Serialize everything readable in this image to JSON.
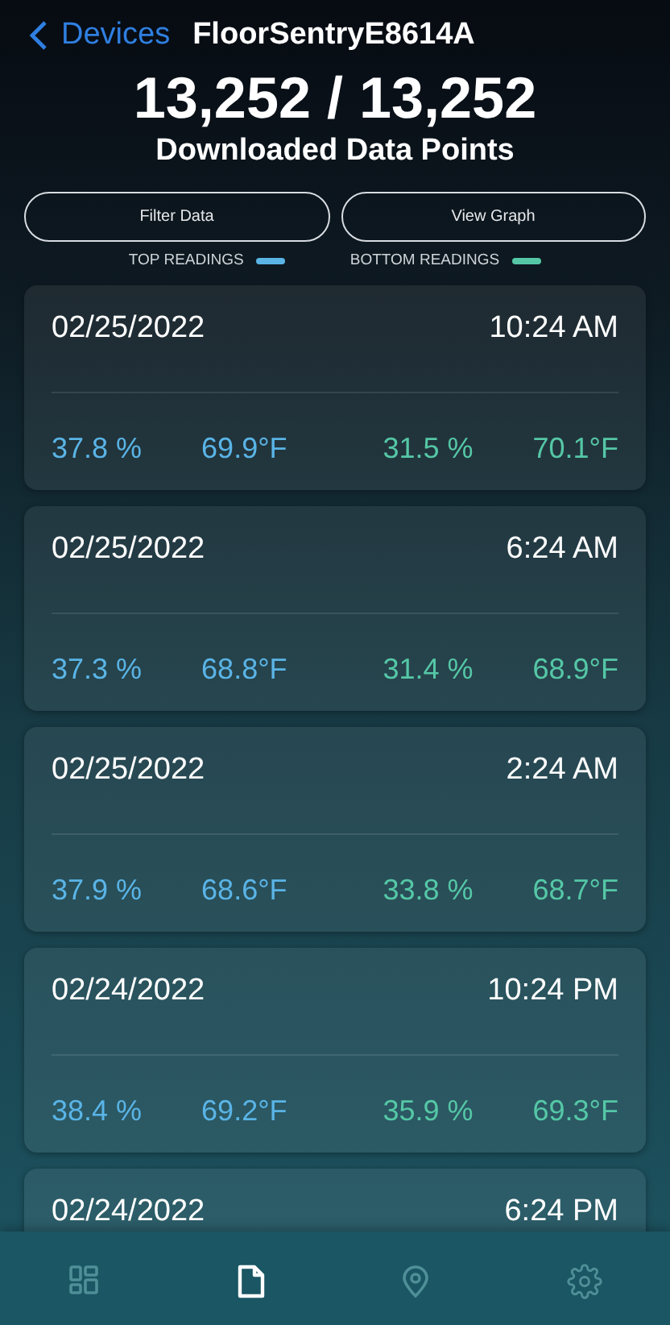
{
  "nav": {
    "back_label": "Devices",
    "title": "FloorSentryE8614A"
  },
  "summary": {
    "count": "13,252 / 13,252",
    "caption": "Downloaded Data Points"
  },
  "buttons": [
    "Filter Data",
    "View Graph"
  ],
  "legend": [
    {
      "label": "TOP READINGS",
      "color": "#5ab4e6"
    },
    {
      "label": "BOTTOM READINGS",
      "color": "#55c7a6"
    }
  ],
  "readings": [
    {
      "date": "02/25/2022",
      "time": "10:24 AM",
      "top_humidity": "37.8 %",
      "top_temp": "69.9°F",
      "bottom_humidity": "31.5 %",
      "bottom_temp": "70.1°F"
    },
    {
      "date": "02/25/2022",
      "time": "6:24 AM",
      "top_humidity": "37.3 %",
      "top_temp": "68.8°F",
      "bottom_humidity": "31.4 %",
      "bottom_temp": "68.9°F"
    },
    {
      "date": "02/25/2022",
      "time": "2:24 AM",
      "top_humidity": "37.9 %",
      "top_temp": "68.6°F",
      "bottom_humidity": "33.8 %",
      "bottom_temp": "68.7°F"
    },
    {
      "date": "02/24/2022",
      "time": "10:24 PM",
      "top_humidity": "38.4 %",
      "top_temp": "69.2°F",
      "bottom_humidity": "35.9 %",
      "bottom_temp": "69.3°F"
    },
    {
      "date": "02/24/2022",
      "time": "6:24 PM"
    }
  ],
  "tabs": [
    {
      "kind": "dashboard",
      "selected": false
    },
    {
      "kind": "document",
      "selected": true
    },
    {
      "kind": "location",
      "selected": false
    },
    {
      "kind": "settings",
      "selected": false
    }
  ]
}
